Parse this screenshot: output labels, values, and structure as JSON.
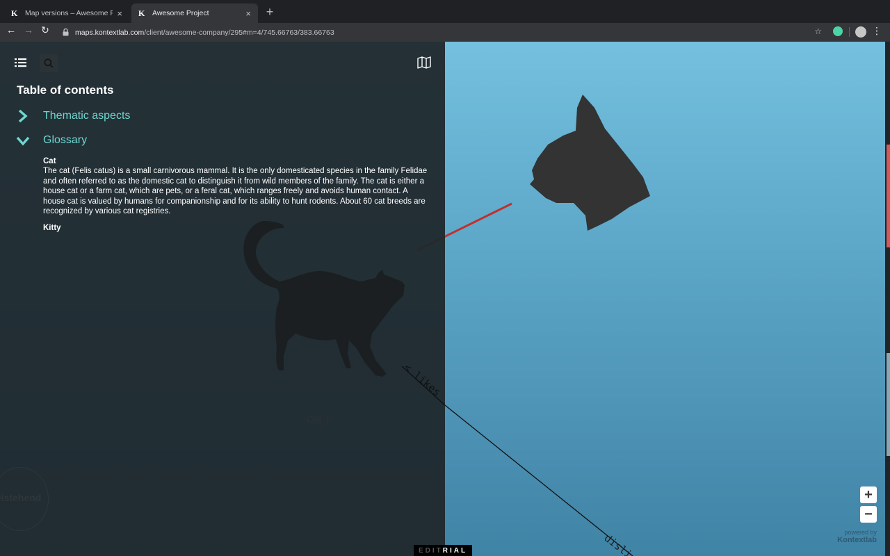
{
  "browser": {
    "tabs": [
      {
        "favicon": "K",
        "title": "Map versions – Awesome Proje",
        "close": "×"
      },
      {
        "favicon": "K",
        "title": "Awesome Project",
        "close": "×"
      }
    ],
    "new_tab": "+",
    "url_host": "maps.kontextlab.com",
    "url_path": "/client/awesome-company/295#m=4/745.66763/383.66763"
  },
  "panel": {
    "toc_title": "Table of contents",
    "items": [
      {
        "label": "Thematic aspects",
        "expanded": false
      },
      {
        "label": "Glossary",
        "expanded": true
      }
    ],
    "glossary": [
      {
        "term": "Cat",
        "definition": "The cat (Felis catus) is a small carnivorous mammal. It is the only domesticated species in the family Felidae and often referred to as the domestic cat to distinguish it from wild members of the family. The cat is either a house cat or a farm cat, which are pets, or a feral cat, which ranges freely and avoids human contact. A house cat is valued by humans for companionship and for its ability to hunt rodents. About 60 cat breeds are recognized by various cat registries."
      },
      {
        "term": "Kitty",
        "definition": ""
      }
    ]
  },
  "map": {
    "node_label": "Cat 1",
    "edge_likes": "< likes",
    "edge_dislikes": "disli",
    "badge_text": "eistehend",
    "zoom_in": "+",
    "zoom_out": "−",
    "powered_by": "powered by",
    "brand": "Kontextlab"
  },
  "footer": {
    "editorial_dim": "EDIT",
    "editorial_bright": "RIAL"
  },
  "colors": {
    "panel_bg": "#1f272c",
    "accent": "#6fd6cf",
    "map_top": "#74c0de",
    "map_bottom": "#3f83a5",
    "edge_red": "#c0302c"
  }
}
